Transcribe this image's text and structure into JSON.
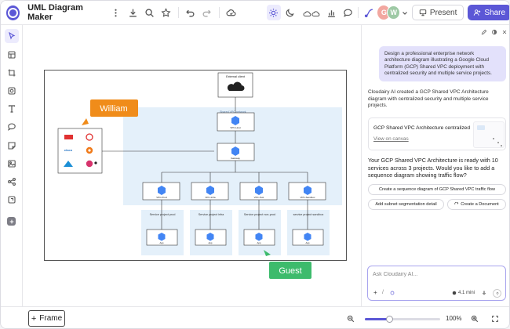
{
  "header": {
    "title": "UML Diagram Maker",
    "avatars": [
      "G",
      "W"
    ],
    "present_label": "Present",
    "share_label": "Share"
  },
  "canvas": {
    "external_client_label": "External client",
    "shared_vpc_label": "Shared VPC network",
    "vpc_node_label": "VPC-Host",
    "gateway_label": "Gateway",
    "subnet_nodes": [
      "VPC-Prod",
      "VPC-Infra",
      "VPC-Test",
      "VPC-Sandbox"
    ],
    "service_projects": [
      "Service project prod",
      "Service project infra",
      "Service project non-prod",
      "service project sandbox"
    ],
    "service_node_label": "App",
    "onprem_vendors": [
      "Fortinet",
      "F5",
      "Cisco",
      "Palo",
      "Meraki",
      "Kali"
    ],
    "cursor_william": "William",
    "cursor_guest": "Guest",
    "colors": {
      "william": "#f08c1a",
      "guest": "#3dbb6c",
      "accent": "#5b57d6",
      "area": "#e4f0fa",
      "gcp_blue": "#4285f4"
    }
  },
  "chat": {
    "user_prompt": "Design a professional enterprise network architecture diagram illustrating a Google Cloud Platform (GCP) Shared VPC deployment with centralized security and multiple service projects.",
    "ai_intro": "Cloudairy AI created a GCP Shared VPC Architecture diagram with centralized security and multiple service projects.",
    "card_title": "GCP Shared VPC Architecture centralized",
    "card_link": "View on canvas",
    "ai_followup": "Your GCP Shared VPC Architecture is ready with 10 services across 3 projects. Would you like to add a sequence diagram showing traffic flow?",
    "suggestions": [
      "Create a sequence diagram of GCP Shared VPC traffic flow",
      "Add subnet segmentation detail",
      "Create a Document"
    ],
    "composer_placeholder": "Ask Cloudairy AI...",
    "model_label": "4.1 mini"
  },
  "footer": {
    "frame_label": "Frame",
    "zoom_level": "100%",
    "zoom_fraction": 0.33
  }
}
